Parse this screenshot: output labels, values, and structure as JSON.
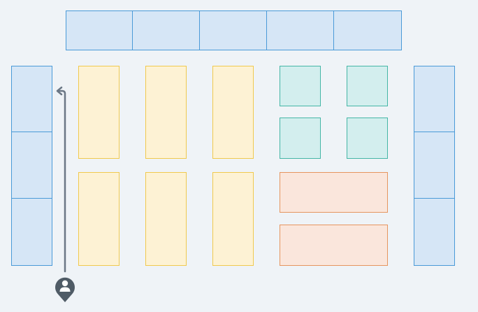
{
  "floor_plan": {
    "colors": {
      "background": "#eff3f7",
      "shelf_fill": "#d6e6f6",
      "shelf_border": "#4a9ad8",
      "aisle_fill": "#fdf2d4",
      "aisle_border": "#f0c94e",
      "display_fill": "#d3eeee",
      "display_border": "#44b6a6",
      "counter_fill": "#fae6dc",
      "counter_border": "#e6955f",
      "path_color": "#6b7785",
      "person_marker": "#4f5b66"
    },
    "icons": {
      "entrance_marker": "person-pin-icon",
      "path_arrow": "arrow-up-icon"
    }
  }
}
